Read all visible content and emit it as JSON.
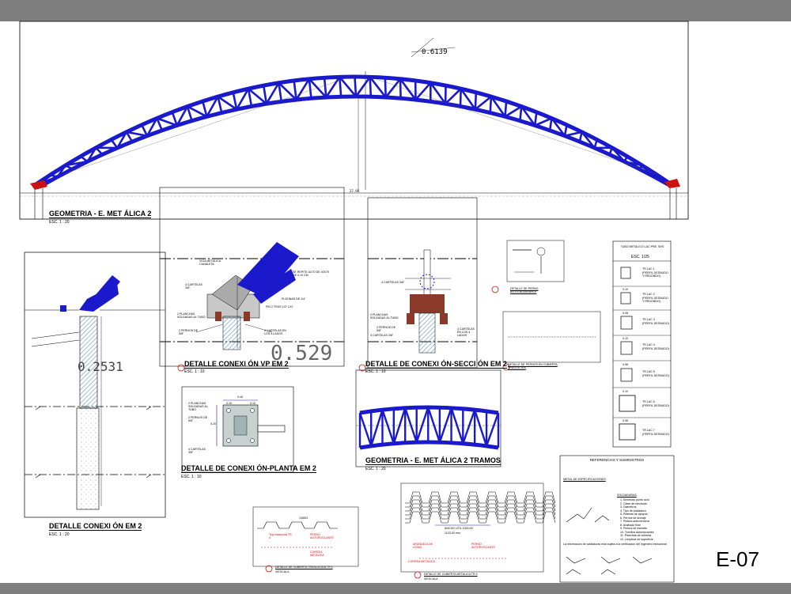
{
  "sheet": {
    "code": "E-07"
  },
  "colors": {
    "truss": "#1a1acc",
    "steel": "#8b3a2a",
    "hatch": "#7aa0c0",
    "red": "#cc1111"
  },
  "elevation": {
    "title": "GEOMETRIA - E. MET ÁLICA 2",
    "scale": "ESC. 1 : 20",
    "dim_top": "0.6139",
    "span": "27.98"
  },
  "conn_em2": {
    "title": "DETALLE CONEXI ÓN EM 2",
    "scale": "ESC. 1 : 20",
    "dim": "0.2531"
  },
  "conn_vp": {
    "title": "DETALLE CONEXI ÓN VP EM 2",
    "scale": "ESC. 1 : 10",
    "dim": "0.529",
    "notes": [
      "VIGA METALICA CANALETA",
      "SE REPITE ALTO DE 40X70 DE 0.10 CM",
      "PLATINAS DE 1/4\"",
      "PIN 2 TRUS 1/2\" LX2",
      "4 CARTELAS 3/8\"",
      "2 PLANCHAS SOLDADAS AL TUBO",
      "2 PERNOS DE 5/8\"",
      "4 CARTELAS EN LOS 4 LADOS"
    ]
  },
  "conn_sec": {
    "title": "DETALLE DE CONEXI ÓN-SECCI ÓN EM 2",
    "scale": "ESC. 1 : 10",
    "notes": [
      "4 CARTELAS 3/8\"",
      "2 PLANCHAS SOLDADAS AL TUBO",
      "2 PERNOS DE 5/8\"",
      "4 CARTELAS 3/8\"",
      "4 CARTELAS EN LOS 4 LADOS"
    ]
  },
  "conn_plan": {
    "title": "DETALLE DE CONEXI ÓN-PLANTA EM 2",
    "scale": "ESC. 1 : 10",
    "dims": [
      "0.40",
      "0.10",
      "0.20",
      "0.10"
    ],
    "notes": [
      "2 PLANCHAS SOLDADAS AL TUBO",
      "2 PERNOS DE 5/8\"",
      "4 CARTELAS 3/8\""
    ]
  },
  "geom_2t": {
    "title": "GEOMETRIA - E. MET ÁLICA 2 TRAMOS",
    "scale": "ESC. 1 : 20"
  },
  "perno": {
    "title": "DETALLE DE PERNO AUTOTALADRANTE"
  },
  "pernos_cubierta": {
    "title": "DETALLE DE PERNOS EN CUBIERTA TRASLUCIDA"
  },
  "tubos": {
    "title": "TUBO METALICO LAC PRE. SHS",
    "scale": "ESC. 1/25",
    "items": [
      {
        "label": "TR LAC 1",
        "dim": "",
        "desc": "(PERFIL DESNUDO Y REDONDO)"
      },
      {
        "label": "TR LAC 2",
        "dim": "0.10",
        "desc": "(PERFIL DESNUDO Y REDONDO)"
      },
      {
        "label": "TR LAC 3",
        "dim": "0.08",
        "desc": "(PERFIL DESNUDO)"
      },
      {
        "label": "TR LAC 4",
        "dim": "0.10",
        "desc": "(PERFIL DESNUDO)"
      },
      {
        "label": "TR LAC 5",
        "dim": "0.08",
        "desc": "(PERFIL DESNUDO)"
      },
      {
        "label": "TR LAC 6",
        "dim": "0.10",
        "desc": "(PERFIL DESNUDO)"
      },
      {
        "label": "TR LAC 7",
        "dim": "0.08",
        "desc": "(PERFIL DESNUDO)"
      }
    ]
  },
  "specs": {
    "title": "REFERENCIAS Y SUMINISTROS",
    "section1": "METAL DE ESPECIFICACIONES",
    "section2": "SOLDADURAS",
    "list": [
      "1. Electrodo punto azul",
      "2. Clase de electrodo",
      "3. Diametros",
      "4. Tipo de soldadura",
      "5. Platinas de apoyos",
      "6. Pernos de anclaje",
      "7. Pintura anticorrosiva",
      "8. Acabado final",
      "9. Pintura de esmalte",
      "10. Tornillos autoroscantes",
      "11. Planchas de cubierta",
      "12. Limpieza de superficie"
    ],
    "footer": "La informacion de soldaduras esta sujeta a la verificacion del ingeniero estructural"
  },
  "cub_trasl": {
    "title": "DETALLE DE CUBIERTA TRASLUCIDA TR 4",
    "scale": "S/ESCALA",
    "dim": "1365/3",
    "notes": [
      "Teja traslucida TR 4",
      "PERNO AUTOROSCANTE",
      "CORREA METALICA"
    ]
  },
  "cub_met": {
    "title": "DETALLE DE CUBIERTA METALICA TR 4",
    "scale": "S/ESCALA",
    "dims": [
      "ANCHO UTIL 1000.00",
      "1133.00 mm"
    ],
    "notes": [
      "ARANDELA DE GOMA",
      "PERNO AUTOROSCANTE",
      "CORREA METALICA"
    ]
  }
}
